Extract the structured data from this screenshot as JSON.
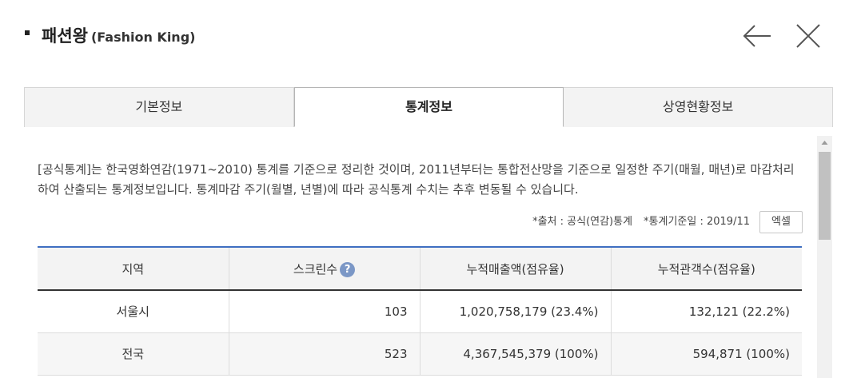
{
  "header": {
    "title": "패션왕",
    "title_en": "(Fashion King)"
  },
  "icons": {
    "back": "arrow-left-icon",
    "close": "close-icon",
    "help": "question-icon"
  },
  "tabs": [
    {
      "label": "기본정보",
      "active": false
    },
    {
      "label": "통계정보",
      "active": true
    },
    {
      "label": "상영현황정보",
      "active": false
    }
  ],
  "notice": "[공식통계]는 한국영화연감(1971~2010) 통계를 기준으로 정리한 것이며, 2011년부터는 통합전산망을 기준으로 일정한 주기(매월, 매년)로 마감처리하여 산출되는 통계정보입니다. 통계마감 주기(월별, 년별)에 따라 공식통계 수치는 추후 변동될 수 있습니다.",
  "meta": {
    "source": "*출처 : 공식(연감)통계",
    "base_date": "*통계기준일 : 2019/11",
    "excel_label": "엑셀"
  },
  "table": {
    "headers": {
      "region": "지역",
      "screens": "스크린수",
      "help_glyph": "?",
      "revenue": "누적매출액(점유율)",
      "audience": "누적관객수(점유율)"
    },
    "rows": [
      {
        "region": "서울시",
        "screens": "103",
        "revenue": "1,020,758,179 (23.4%)",
        "audience": "132,121 (22.2%)"
      },
      {
        "region": "전국",
        "screens": "523",
        "revenue": "4,367,545,379 (100%)",
        "audience": "594,871 (100%)"
      }
    ]
  },
  "colors": {
    "table_top_border": "#3f6fc1",
    "help_icon_bg": "#7b97c6"
  }
}
